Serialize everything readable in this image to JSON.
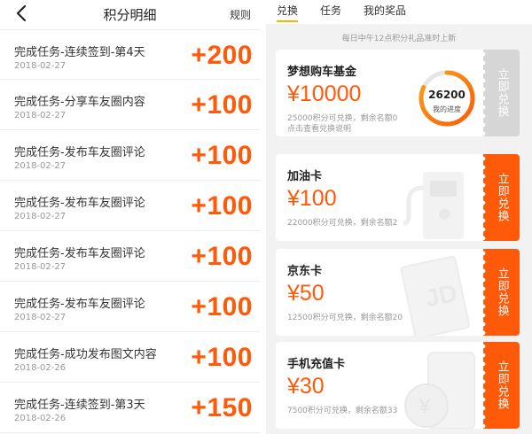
{
  "left": {
    "title": "积分明细",
    "rules_label": "规则",
    "records": [
      {
        "title": "完成任务-连续签到-第4天",
        "date": "2018-02-27",
        "points": "+200"
      },
      {
        "title": "完成任务-分享车友圈内容",
        "date": "2018-02-27",
        "points": "+100"
      },
      {
        "title": "完成任务-发布车友圈评论",
        "date": "2018-02-27",
        "points": "+100"
      },
      {
        "title": "完成任务-发布车友圈评论",
        "date": "2018-02-27",
        "points": "+100"
      },
      {
        "title": "完成任务-发布车友圈评论",
        "date": "2018-02-27",
        "points": "+100"
      },
      {
        "title": "完成任务-发布车友圈评论",
        "date": "2018-02-27",
        "points": "+100"
      },
      {
        "title": "完成任务-成功发布图文内容",
        "date": "2018-02-26",
        "points": "+100"
      },
      {
        "title": "完成任务-连续签到-第3天",
        "date": "2018-02-26",
        "points": "+150"
      }
    ]
  },
  "right": {
    "tabs": [
      {
        "label": "兑换",
        "active": true
      },
      {
        "label": "任务",
        "active": false
      },
      {
        "label": "我的奖品",
        "active": false
      }
    ],
    "notice": "每日中午12点积分礼品准时上新",
    "cards": [
      {
        "name": "梦想购车基金",
        "price": "¥10000",
        "desc": "25000积分可兑换，剩余名额0",
        "sub": "点击查看兑换说明",
        "button": "立即兑换",
        "enabled": false
      },
      {
        "name": "加油卡",
        "price": "¥100",
        "desc": "22000积分可兑换，剩余名额2",
        "sub": "",
        "button": "立即兑换",
        "enabled": true
      },
      {
        "name": "京东卡",
        "price": "¥50",
        "desc": "12500积分可兑换，剩余名额20",
        "sub": "",
        "button": "立即兑换",
        "enabled": true
      },
      {
        "name": "手机充值卡",
        "price": "¥30",
        "desc": "7500积分可兑换，剩余名额33",
        "sub": "",
        "button": "立即兑换",
        "enabled": true
      }
    ],
    "progress": {
      "value": "26200",
      "label": "我的进度",
      "fraction": 0.82
    },
    "watermark_jd": "JD",
    "colors": {
      "accent": "#ff5a0a",
      "tab_underline": "#f7b500",
      "disabled": "#d6d6d6",
      "ring_start": "#ff5a0a",
      "ring_end": "#f7a21b",
      "ring_track": "#e6e6e6"
    },
    "icons": {
      "back": "chevron-left-icon",
      "fuel": "fuel-pump-icon",
      "jd": "jd-card-icon",
      "phone": "phone-icon",
      "yuan": "yuan-coin-icon"
    }
  }
}
